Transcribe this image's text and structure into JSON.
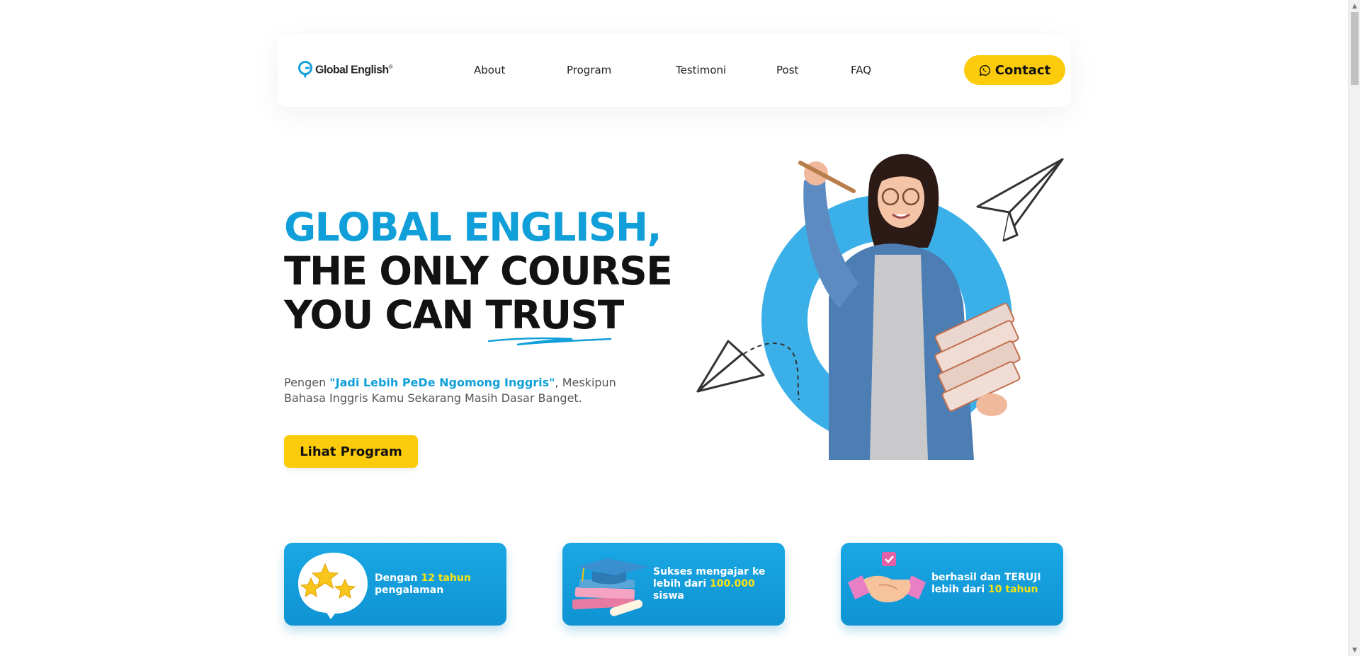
{
  "nav": {
    "logo_text": "Global English",
    "logo_reg": "®",
    "items": [
      {
        "label": "About"
      },
      {
        "label": "Program"
      },
      {
        "label": "Testimoni"
      },
      {
        "label": "Post"
      },
      {
        "label": "FAQ"
      }
    ],
    "contact_label": "Contact",
    "contact_icon": "whatsapp-icon"
  },
  "hero": {
    "title_line1": "GLOBAL ENGLISH,",
    "title_line2": "THE ONLY COURSE",
    "title_line3_pre": "YOU CAN ",
    "title_line3_word": "TRUST",
    "desc_pre": "Pengen ",
    "desc_highlight": "\"Jadi Lebih PeDe Ngomong Inggris\"",
    "desc_post": ", Meskipun Bahasa Inggris Kamu Sekarang Masih Dasar Banget.",
    "cta_label": "Lihat Program"
  },
  "cards": [
    {
      "pre": "Dengan ",
      "highlight": "12 tahun",
      "post": "pengalaman",
      "icon": "stars-bubble-icon"
    },
    {
      "pre": "Sukses mengajar ke lebih dari ",
      "highlight": "100.000",
      "post": "siswa",
      "icon": "graduation-books-icon"
    },
    {
      "pre": "berhasil dan TERUJI lebih dari ",
      "highlight": "10 tahun",
      "post": "",
      "icon": "handshake-icon"
    }
  ],
  "colors": {
    "accent_blue": "#109fd9",
    "accent_yellow": "#fccb0b",
    "highlight_yellow": "#fce310"
  }
}
